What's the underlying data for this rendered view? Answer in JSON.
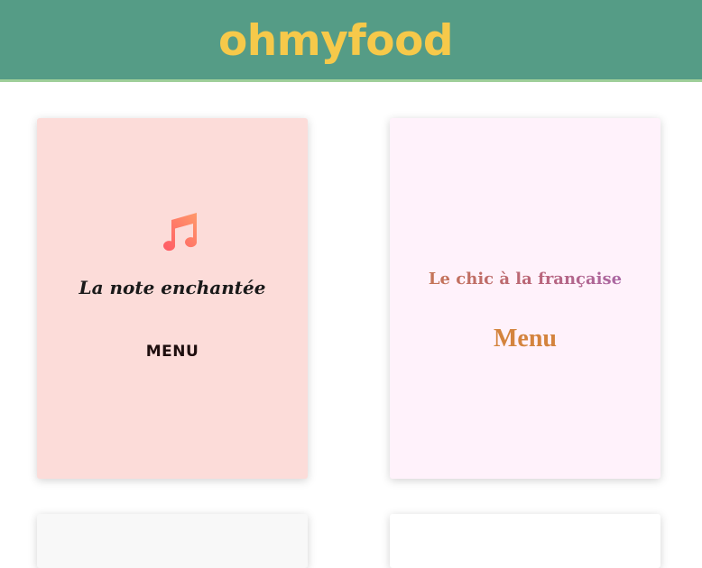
{
  "header": {
    "logo": "ohmyfood",
    "background_color": "#559c86",
    "logo_color": "#f6c94a"
  },
  "cards": [
    {
      "icon": "music-note-icon",
      "title": "La note enchantée",
      "menu_label": "MENU",
      "background_color": "#fcdcd9"
    },
    {
      "title": "Le chic à la française",
      "menu_label": "Menu",
      "background_color": "#fff2fb",
      "menu_color": "#d4843e"
    },
    {
      "background_color": "#f8f8f8"
    },
    {
      "background_color": "#ffffff"
    }
  ]
}
